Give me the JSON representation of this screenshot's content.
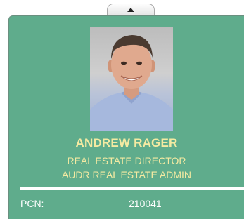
{
  "card": {
    "name": "ANDREW RAGER",
    "title": "REAL ESTATE DIRECTOR",
    "department": "AUDR REAL ESTATE ADMIN",
    "pcn_label": "PCN:",
    "pcn_value": "210041"
  },
  "colors": {
    "card_background": "#5fac8c",
    "name_text": "#f4eaa2",
    "label_text": "#ffffff"
  },
  "icons": {
    "collapse": "chevron-up-icon"
  }
}
